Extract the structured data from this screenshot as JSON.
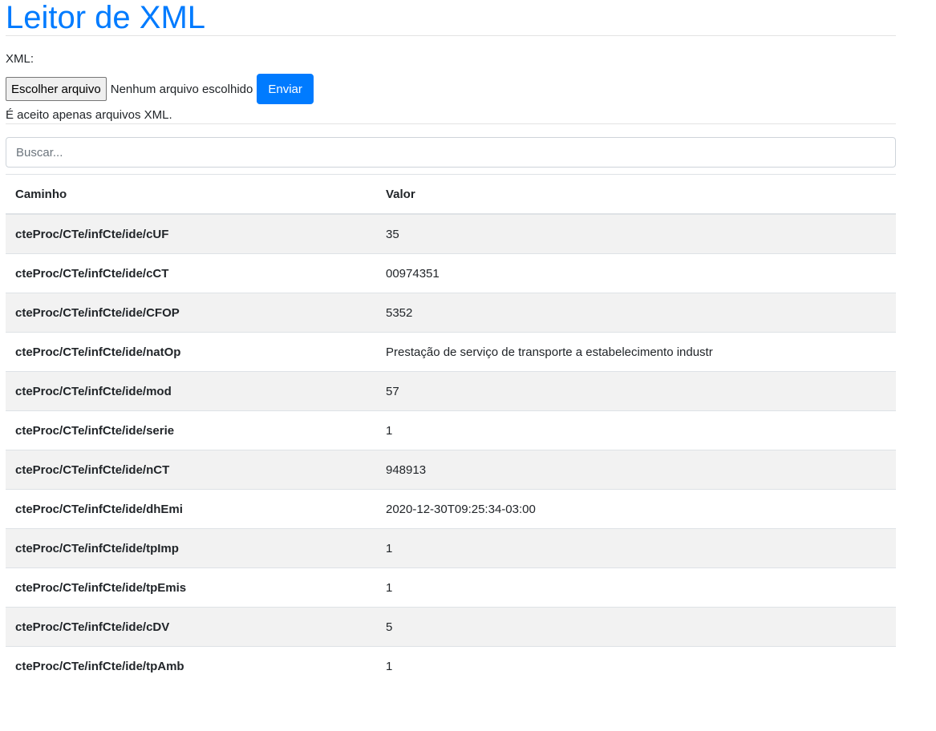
{
  "header": {
    "title": "Leitor de XML"
  },
  "upload": {
    "label": "XML:",
    "file_button": "Escolher arquivo",
    "file_status": "Nenhum arquivo escolhido",
    "send_button": "Enviar",
    "help_text": "É aceito apenas arquivos XML."
  },
  "search": {
    "placeholder": "Buscar..."
  },
  "table": {
    "columns": [
      "Caminho",
      "Valor"
    ],
    "rows": [
      {
        "path": "cteProc/CTe/infCte/ide/cUF",
        "value": "35"
      },
      {
        "path": "cteProc/CTe/infCte/ide/cCT",
        "value": "00974351"
      },
      {
        "path": "cteProc/CTe/infCte/ide/CFOP",
        "value": "5352"
      },
      {
        "path": "cteProc/CTe/infCte/ide/natOp",
        "value": "Prestação de serviço de transporte a estabelecimento industr"
      },
      {
        "path": "cteProc/CTe/infCte/ide/mod",
        "value": "57"
      },
      {
        "path": "cteProc/CTe/infCte/ide/serie",
        "value": "1"
      },
      {
        "path": "cteProc/CTe/infCte/ide/nCT",
        "value": "948913"
      },
      {
        "path": "cteProc/CTe/infCte/ide/dhEmi",
        "value": "2020-12-30T09:25:34-03:00"
      },
      {
        "path": "cteProc/CTe/infCte/ide/tpImp",
        "value": "1"
      },
      {
        "path": "cteProc/CTe/infCte/ide/tpEmis",
        "value": "1"
      },
      {
        "path": "cteProc/CTe/infCte/ide/cDV",
        "value": "5"
      },
      {
        "path": "cteProc/CTe/infCte/ide/tpAmb",
        "value": "1"
      }
    ]
  },
  "colors": {
    "accent": "#007bff",
    "stripe": "#f2f2f2",
    "border": "#dee2e6"
  }
}
